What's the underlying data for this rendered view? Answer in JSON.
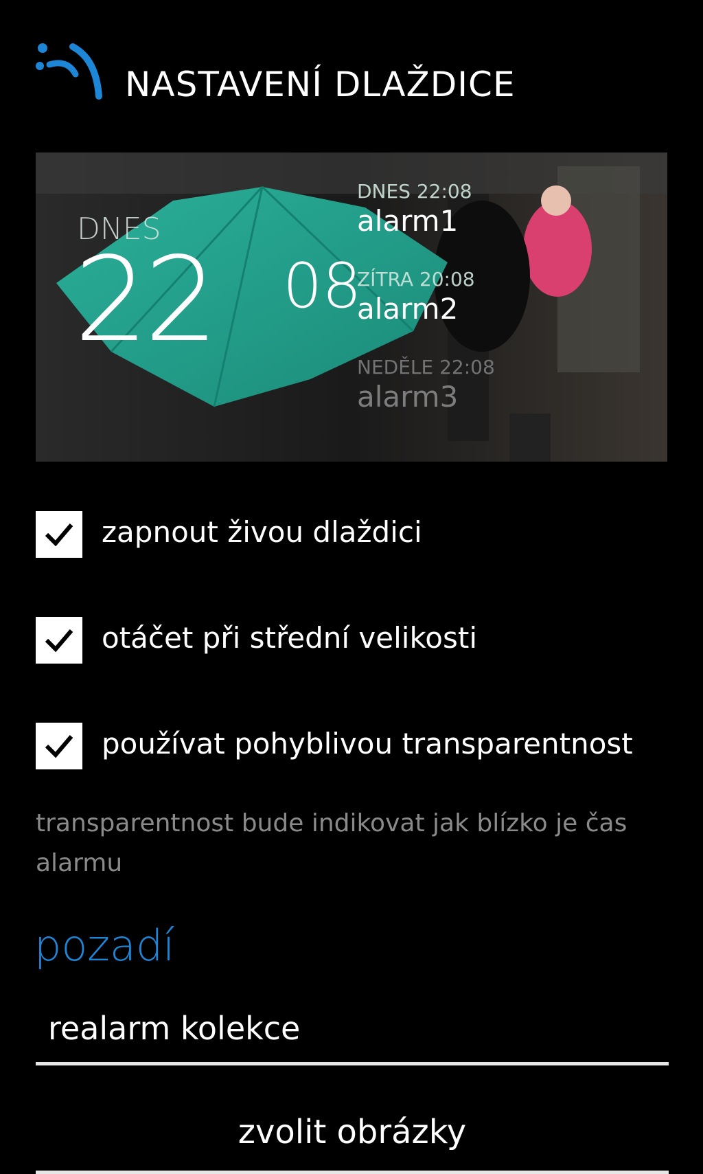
{
  "header": {
    "title": "NASTAVENÍ DLAŽDICE"
  },
  "tile_preview": {
    "big_label": "DNES",
    "big_hour": "22",
    "big_minutes": "08",
    "alarms": [
      {
        "when": "DNES 22:08",
        "name": "alarm1"
      },
      {
        "when": "ZÍTRA 20:08",
        "name": "alarm2"
      },
      {
        "when": "NEDĚLE 22:08",
        "name": "alarm3"
      }
    ]
  },
  "options": [
    {
      "label": "zapnout živou dlaždici",
      "checked": true
    },
    {
      "label": "otáčet při střední velikosti",
      "checked": true
    },
    {
      "label": "používat pohyblivou transparentnost",
      "checked": true
    }
  ],
  "hint": "transparentnost bude indikovat jak blízko je čas alarmu",
  "background": {
    "section_title": "pozadí",
    "picker_value": "realarm kolekce",
    "choose_button": "zvolit obrázky"
  },
  "colors": {
    "accent": "#1e86d6",
    "umbrella": "#1f9a86"
  }
}
